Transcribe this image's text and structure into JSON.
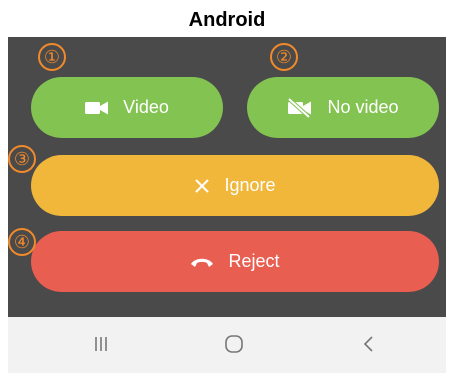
{
  "header": {
    "title": "Android"
  },
  "badges": [
    "①",
    "②",
    "③",
    "④"
  ],
  "buttons": {
    "video": "Video",
    "no_video": "No video",
    "ignore": "Ignore",
    "reject": "Reject"
  },
  "icons": {
    "video": "videocam-icon",
    "no_video": "videocam-off-icon",
    "ignore": "close-icon",
    "reject": "call-end-icon",
    "nav_recents": "recents-icon",
    "nav_home": "home-icon",
    "nav_back": "back-icon"
  },
  "colors": {
    "screen_bg": "#4a4a4a",
    "green": "#83c352",
    "yellow": "#f0b73b",
    "red": "#e85e50",
    "badge": "#f28a2b",
    "navbar_bg": "#f2f2f2"
  }
}
